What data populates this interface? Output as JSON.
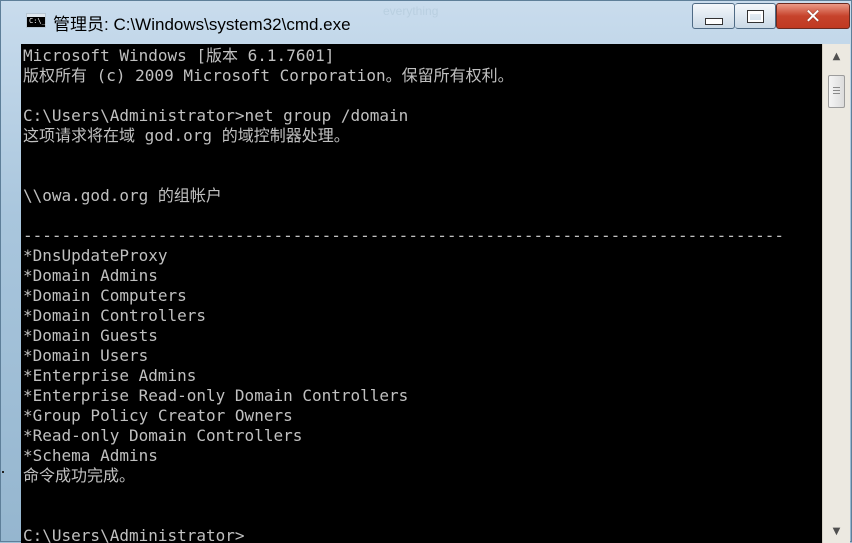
{
  "window": {
    "title": "管理员: C:\\Windows\\system32\\cmd.exe",
    "ghost_title": "everything",
    "minimize_glyph": "minimize-icon",
    "maximize_glyph": "maximize-icon",
    "close_glyph": "✕",
    "app_icon_text": "C:\\_"
  },
  "console": {
    "lines": [
      "Microsoft Windows [版本 6.1.7601]",
      "版权所有 (c) 2009 Microsoft Corporation。保留所有权利。",
      "",
      "C:\\Users\\Administrator>net group /domain",
      "这项请求将在域 god.org 的域控制器处理。",
      "",
      "",
      "\\\\owa.god.org 的组帐户",
      "",
      "-------------------------------------------------------------------------------",
      "*DnsUpdateProxy",
      "*Domain Admins",
      "*Domain Computers",
      "*Domain Controllers",
      "*Domain Guests",
      "*Domain Users",
      "*Enterprise Admins",
      "*Enterprise Read-only Domain Controllers",
      "*Group Policy Creator Owners",
      "*Read-only Domain Controllers",
      "*Schema Admins",
      "命令成功完成。",
      "",
      "",
      "C:\\Users\\Administrator>"
    ]
  },
  "scrollbar": {
    "up_arrow": "▲",
    "down_arrow": "▼"
  },
  "colors": {
    "console_bg": "#000000",
    "console_fg": "#c0c0c0",
    "close_red": "#c6432c"
  }
}
